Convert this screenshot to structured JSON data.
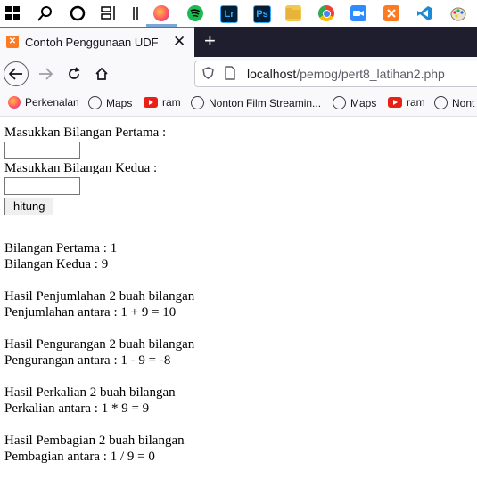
{
  "browser": {
    "tab_title": "Contoh Penggunaan UDF",
    "url_host": "localhost",
    "url_path": "/pemog/pert8_latihan2.php"
  },
  "bookmarks": [
    {
      "label": "Perkenalan",
      "icon": "firefox-icon"
    },
    {
      "label": "Maps",
      "icon": "globe-icon"
    },
    {
      "label": "ram",
      "icon": "youtube-icon"
    },
    {
      "label": "Nonton Film Streamin...",
      "icon": "globe-icon"
    },
    {
      "label": "Maps",
      "icon": "globe-icon"
    },
    {
      "label": "ram",
      "icon": "youtube-icon"
    },
    {
      "label": "Nont",
      "icon": "globe-icon"
    }
  ],
  "taskbar": {
    "lr_label": "Lr",
    "ps_label": "Ps"
  },
  "form": {
    "label_first": "Masukkan Bilangan Pertama :",
    "label_second": "Masukkan Bilangan Kedua :",
    "first_value": "",
    "second_value": "",
    "submit_label": "hitung"
  },
  "results": {
    "first_line": "Bilangan Pertama : 1",
    "second_line": "Bilangan Kedua : 9",
    "add_heading": "Hasil Penjumlahan 2 buah bilangan",
    "add_line": "Penjumlahan antara : 1 + 9 = 10",
    "sub_heading": "Hasil Pengurangan 2 buah bilangan",
    "sub_line": "Pengurangan antara : 1 - 9 = -8",
    "mul_heading": "Hasil Perkalian 2 buah bilangan",
    "mul_line": "Perkalian antara : 1 * 9 = 9",
    "div_heading": "Hasil Pembagian 2 buah bilangan",
    "div_line": "Pembagian antara : 1 / 9 = 0"
  },
  "colors": {
    "tab_accent": "#0a84ff",
    "tabstrip_bg": "#1f1e2e",
    "xampp_orange": "#fb7a24"
  }
}
